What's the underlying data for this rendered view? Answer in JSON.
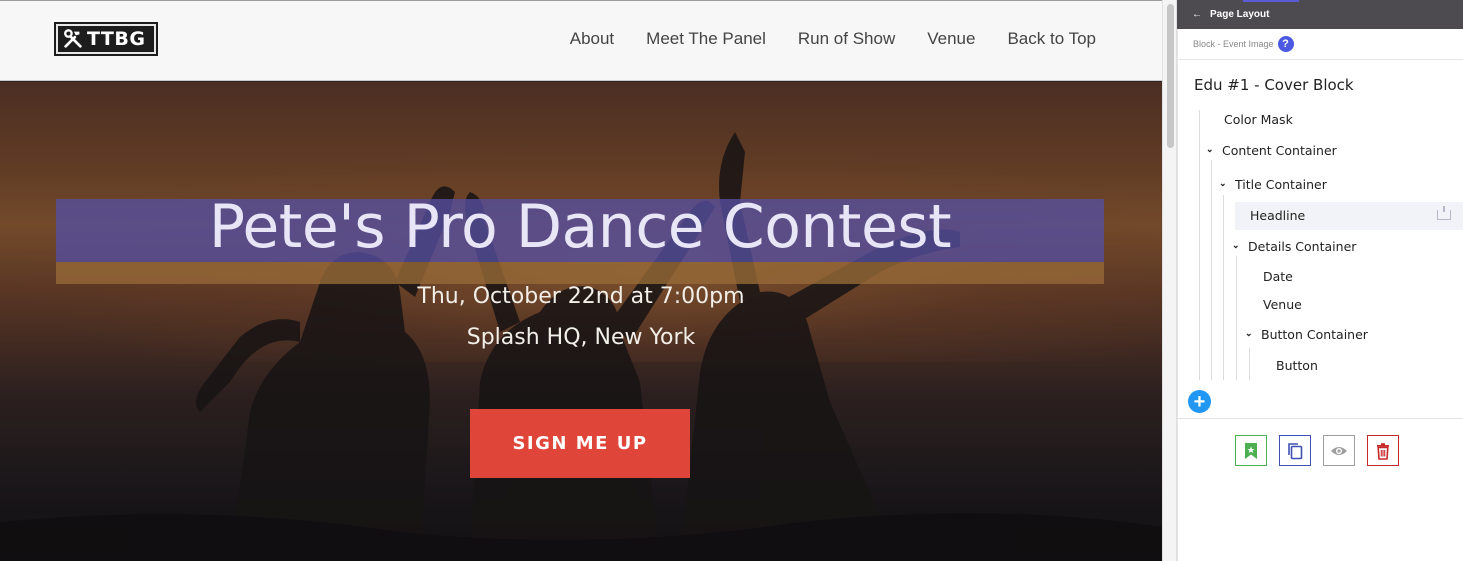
{
  "site": {
    "logo_text": "TTBG",
    "nav": [
      "About",
      "Meet The Panel",
      "Run of Show",
      "Venue",
      "Back to Top"
    ]
  },
  "hero": {
    "headline": "Pete's Pro Dance Contest",
    "date": "Thu, October 22nd at 7:00pm",
    "venue": "Splash HQ, New York",
    "cta_label": "SIGN ME UP"
  },
  "panel": {
    "back_label": "Page Layout",
    "breadcrumb": "Block - Event Image",
    "help_icon": "?",
    "block_title": "Edu #1 - Cover Block",
    "tree": {
      "color_mask": "Color Mask",
      "content_container": "Content Container",
      "title_container": "Title Container",
      "headline": "Headline",
      "details_container": "Details Container",
      "date": "Date",
      "venue": "Venue",
      "button_container": "Button Container",
      "button": "Button"
    },
    "add_icon": "+"
  },
  "colors": {
    "cta": "#e0453a",
    "headline_highlight": "#544ea0",
    "panel_header": "#4d4a50",
    "add_button": "#2196f3",
    "help_badge": "#4b5ae0",
    "save_action": "#4caf50",
    "copy_action": "#3f51b5",
    "view_action": "#9e9e9e",
    "delete_action": "#c62828"
  },
  "icons": [
    "tools-icon",
    "back-arrow-icon",
    "help-icon",
    "chevron-down-icon",
    "pin-icon",
    "plus-icon",
    "bookmark-icon",
    "copy-icon",
    "eye-icon",
    "trash-icon"
  ]
}
